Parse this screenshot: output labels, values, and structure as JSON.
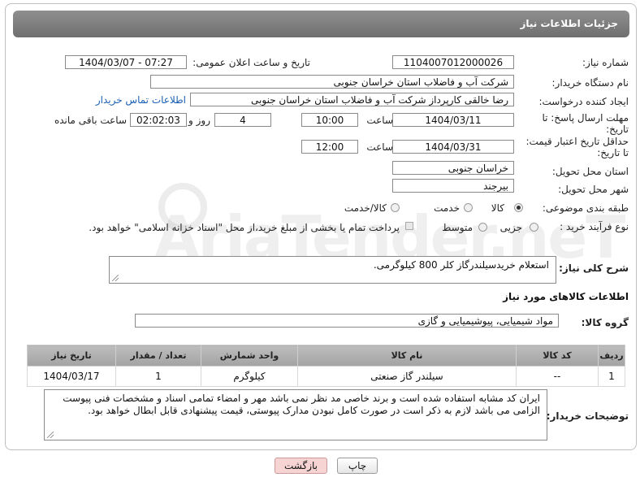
{
  "panel": {
    "title": "جزئیات اطلاعات نیاز"
  },
  "fields": {
    "need_number_label": "شماره نیاز:",
    "need_number": "1104007012000026",
    "announce_label": "تاریخ و ساعت اعلان عمومی:",
    "announce_value": "1404/03/07 - 07:27",
    "buyer_org_label": "نام دستگاه خریدار:",
    "buyer_org": "شرکت آب و فاضلاب استان خراسان جنوبی",
    "creator_label": "ایجاد کننده درخواست:",
    "creator": "رضا خالقی کارپرداز شرکت آب و فاضلاب استان خراسان جنوبی",
    "contact_link": "اطلاعات تماس خریدار",
    "deadline_label_1": "مهلت ارسال پاسخ: تا",
    "deadline_label_2": "تاریخ:",
    "deadline_date": "1404/03/11",
    "time_label": "ساعت",
    "deadline_time": "10:00",
    "days_value": "4",
    "days_label": "روز و",
    "remaining_value": "02:02:03",
    "remaining_label": "ساعت باقی مانده",
    "validity_label_1": "حداقل تاریخ اعتبار قیمت:",
    "validity_label_2": "تا تاریخ:",
    "validity_date": "1404/03/31",
    "validity_time": "12:00",
    "province_label": "استان محل تحویل:",
    "province": "خراسان جنوبی",
    "city_label": "شهر محل تحویل:",
    "city": "بیرجند",
    "category_label": "طبقه بندی موضوعی:",
    "category_options": [
      "کالا",
      "خدمت",
      "کالا/خدمت"
    ],
    "category_selected": "کالا",
    "process_label": "نوع فرآیند خرید :",
    "process_options": [
      "جزیی",
      "متوسط"
    ],
    "process_selected": "",
    "payment_note": "پرداخت تمام یا بخشی از مبلغ خرید،از محل \"اسناد خزانه اسلامی\" خواهد بود.",
    "desc_label": "شرح کلی نیاز:",
    "desc": "استعلام خریدسیلندرگاز کلر 800 کیلوگرمی."
  },
  "goods_section": {
    "title": "اطلاعات کالاهای مورد نیاز",
    "group_label": "گروه کالا:",
    "group_value": "مواد شیمیایی، پیوشیمیایی و  گازی"
  },
  "table": {
    "headers": [
      "ردیف",
      "کد کالا",
      "نام کالا",
      "واحد شمارش",
      "تعداد / مقدار",
      "تاریخ نیاز"
    ],
    "rows": [
      [
        "1",
        "--",
        "سیلندر گاز صنعتی",
        "کیلوگرم",
        "1",
        "1404/03/17"
      ]
    ]
  },
  "buyer_notes": {
    "label": "توضیحات خریدار:",
    "text": "ایران کد مشابه استفاده شده است و برند خاصی مد نظر نمی باشد مهر و امضاء تمامی اسناد و مشخصات فنی پیوست الزامی می باشد لازم به ذکر است در صورت کامل نبودن  مدارک پیوستی،  قیمت پیشنهادی قابل ابطال خواهد بود."
  },
  "buttons": {
    "print": "چاپ",
    "back": "بازگشت"
  },
  "watermark": "AriaTender.neT",
  "colors": {
    "title_bar": "#7f7f7f",
    "link": "#1a5fb4",
    "back_button": "#f7d4d4"
  }
}
